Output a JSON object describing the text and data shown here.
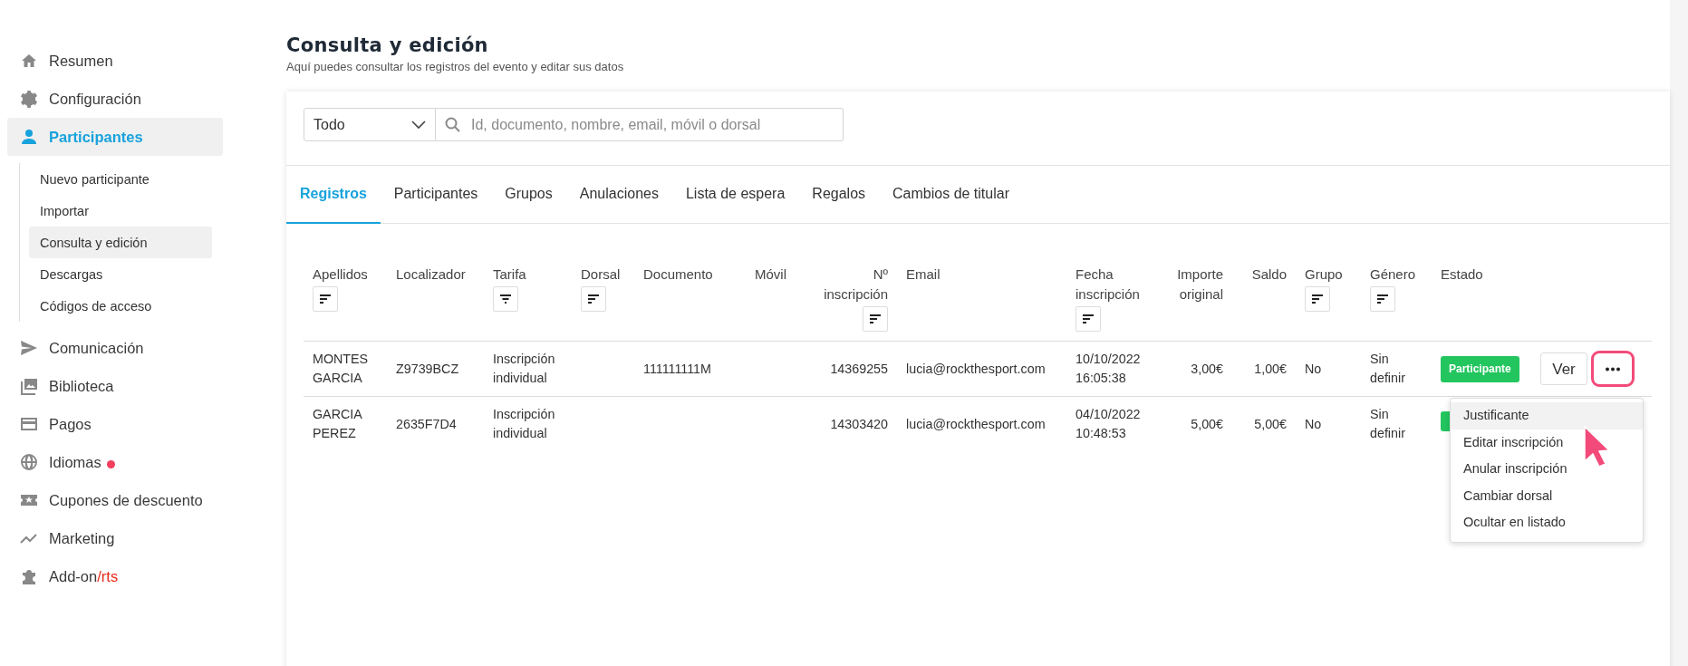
{
  "sidebar": {
    "items": [
      {
        "label": "Resumen",
        "selected": false
      },
      {
        "label": "Configuración",
        "selected": false
      },
      {
        "label": "Participantes",
        "selected": true,
        "children": [
          {
            "label": "Nuevo participante",
            "selected": false
          },
          {
            "label": "Importar",
            "selected": false
          },
          {
            "label": "Consulta y edición",
            "selected": true
          },
          {
            "label": "Descargas",
            "selected": false
          },
          {
            "label": "Códigos de acceso",
            "selected": false
          }
        ]
      },
      {
        "label": "Comunicación",
        "selected": false
      },
      {
        "label": "Biblioteca",
        "selected": false
      },
      {
        "label": "Pagos",
        "selected": false
      },
      {
        "label": "Idiomas",
        "selected": false,
        "color": "#f43f5e"
      },
      {
        "label": "Cupones de descuento",
        "selected": false
      },
      {
        "label": "Marketing",
        "selected": false
      },
      {
        "label": "Add-on",
        "accent": "/rts",
        "selected": false
      }
    ]
  },
  "page": {
    "title": "Consulta y edición",
    "subtitle": "Aquí puedes consultar los registros del evento y editar sus datos"
  },
  "filter": {
    "select_value": "Todo",
    "search_placeholder": "Id, documento, nombre, email, móvil o dorsal"
  },
  "tabs": [
    {
      "label": "Registros",
      "selected": true
    },
    {
      "label": "Participantes",
      "selected": false
    },
    {
      "label": "Grupos",
      "selected": false
    },
    {
      "label": "Anulaciones",
      "selected": false
    },
    {
      "label": "Lista de espera",
      "selected": false
    },
    {
      "label": "Regalos",
      "selected": false
    },
    {
      "label": "Cambios de titular",
      "selected": false
    }
  ],
  "table": {
    "columns": [
      {
        "label": "Apellidos",
        "sortable": true
      },
      {
        "label": "Localizador"
      },
      {
        "label": "Tarifa",
        "filterable": true
      },
      {
        "label": "Dorsal",
        "sortable": true
      },
      {
        "label": "Documento"
      },
      {
        "label": "Móvil"
      },
      {
        "label": "Nº inscripción",
        "sortable": true
      },
      {
        "label": "Email"
      },
      {
        "label": "Fecha inscripción",
        "sortable": true
      },
      {
        "label": "Importe original"
      },
      {
        "label": "Saldo"
      },
      {
        "label": "Grupo",
        "sortable": true
      },
      {
        "label": "Género",
        "sortable": true
      },
      {
        "label": "Estado"
      }
    ],
    "rows": [
      {
        "cells": [
          "MONTES GARCIA",
          "Z9739BCZ",
          "Inscripción individual",
          "",
          "111111111M",
          "",
          "14369255",
          "lucia@rockthesport.com",
          "10/10/2022 16:05:38",
          "3,00€",
          "1,00€",
          "No",
          "Sin definir"
        ],
        "status": {
          "label": "Participante",
          "color": "#22c55e"
        },
        "view_button": "Ver",
        "more_highlighted": true
      },
      {
        "cells": [
          "GARCIA PEREZ",
          "2635F7D4",
          "Inscripción individual",
          "",
          "",
          "",
          "14303420",
          "lucia@rockthesport.com",
          "04/10/2022 10:48:53",
          "5,00€",
          "5,00€",
          "No",
          "Sin definir"
        ],
        "status": {
          "color": "#22c55e"
        }
      }
    ]
  },
  "menu": {
    "items": [
      {
        "label": "Justificante",
        "selected": true
      },
      {
        "label": "Editar inscripción",
        "selected": false
      },
      {
        "label": "Anular inscripción",
        "selected": false
      },
      {
        "label": "Cambiar dorsal",
        "selected": false
      },
      {
        "label": "Ocultar en listado",
        "selected": false
      }
    ]
  }
}
